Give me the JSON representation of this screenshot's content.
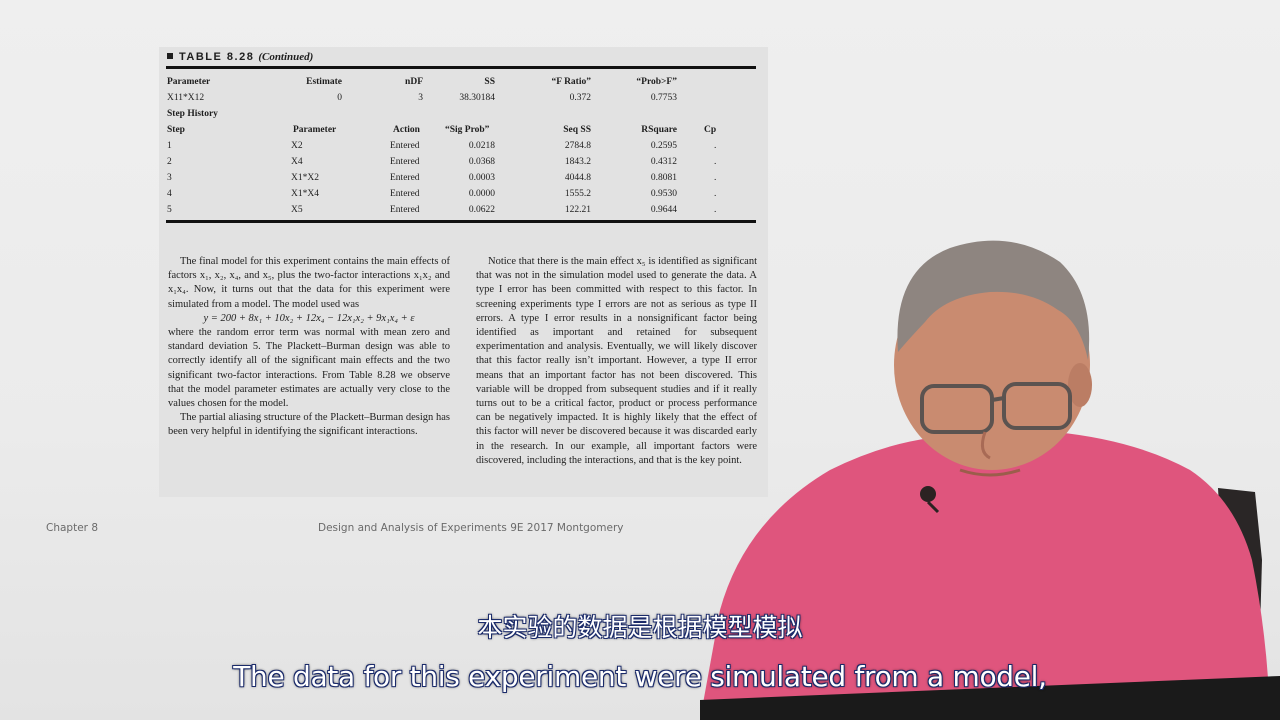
{
  "table": {
    "title": "TABLE 8.28",
    "continued": "(Continued)",
    "top_headers": [
      "Parameter",
      "Estimate",
      "nDF",
      "SS",
      "“F Ratio”",
      "“Prob>F”"
    ],
    "top_row": [
      "X11*X12",
      "0",
      "3",
      "38.30184",
      "0.372",
      "0.7753"
    ],
    "step_history_label": "Step History",
    "step_headers": [
      "Step",
      "Parameter",
      "Action",
      "“Sig Prob”",
      "Seq SS",
      "RSquare",
      "Cp"
    ],
    "step_rows": [
      [
        "1",
        "X2",
        "Entered",
        "0.0218",
        "2784.8",
        "0.2595",
        "."
      ],
      [
        "2",
        "X4",
        "Entered",
        "0.0368",
        "1843.2",
        "0.4312",
        "."
      ],
      [
        "3",
        "X1*X2",
        "Entered",
        "0.0003",
        "4044.8",
        "0.8081",
        "."
      ],
      [
        "4",
        "X1*X4",
        "Entered",
        "0.0000",
        "1555.2",
        "0.9530",
        "."
      ],
      [
        "5",
        "X5",
        "Entered",
        "0.0622",
        "122.21",
        "0.9644",
        "."
      ]
    ]
  },
  "text": {
    "left_p1": "The final model for this experiment contains the main effects of factors x₁, x₂, x₄, and x₅, plus the two-factor interactions x₁x₂ and x₁x₄. Now, it turns out that the data for this experiment were simulated from a model. The model used was",
    "equation": "y = 200 + 8x₁ + 10x₂ + 12x₄ − 12x₁x₂ + 9x₁x₄ + ε",
    "left_p2": "where the random error term was normal with mean zero and standard deviation 5. The Plackett–Burman design was able to correctly identify all of the significant main effects and the two significant two-factor interactions. From Table 8.28 we observe that the model parameter estimates are actually very close to the values chosen for the model.",
    "left_p3": "The partial aliasing structure of the Plackett–Burman design has been very helpful in identifying the significant interactions.",
    "right_p1": "Notice that there is the main effect x₅ is identified as significant that was not in the simulation model used to generate the data. A type I error has been committed with respect to this factor. In screening experiments type I errors are not as serious as type II errors. A type I error results in a nonsignificant factor being identified as important and retained for subsequent experimentation and analysis. Eventually, we will likely discover that this factor really isn’t important. However, a type II error means that an important factor has not been discovered. This variable will be dropped from subsequent studies and if it really turns out to be a critical factor, product or process performance can be negatively impacted. It is highly likely that the effect of this factor will never be discovered because it was discarded early in the research. In our example, all important factors were discovered, including the interactions, and that is the key point."
  },
  "footer": {
    "left": "Chapter 8",
    "center": "Design and Analysis of Experiments 9E 2017 Montgomery"
  },
  "subtitles": {
    "zh": "本实验的数据是根据模型模拟",
    "en": "The data for this experiment were simulated from a model,"
  },
  "colors": {
    "shirt": "#e0567e",
    "skin": "#c98b70",
    "hair": "#8e8580",
    "subtitle_outline": "#1a2a6a"
  }
}
